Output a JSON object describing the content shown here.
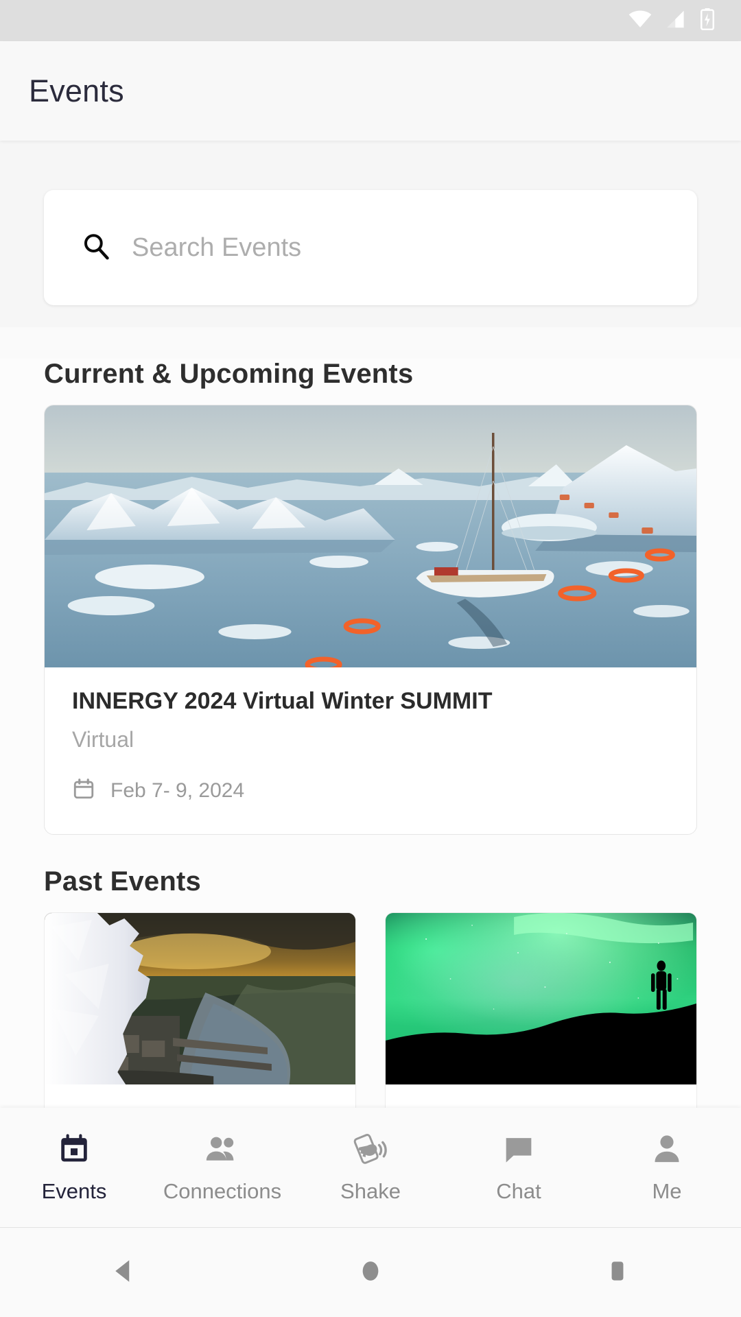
{
  "status_bar": {
    "wifi_icon": "wifi-icon",
    "signal_icon": "cellular-signal-icon",
    "battery_icon": "battery-charging-icon"
  },
  "header": {
    "title": "Events"
  },
  "search": {
    "icon": "search-icon",
    "placeholder": "Search Events",
    "value": ""
  },
  "sections": {
    "current": {
      "title": "Current & Upcoming Events",
      "events": [
        {
          "name": "INNERGY 2024 Virtual Winter SUMMIT",
          "location": "Virtual",
          "date": "Feb  7- 9, 2024",
          "date_icon": "calendar-icon",
          "image_alt": "arctic-icebergs-sailboat"
        }
      ]
    },
    "past": {
      "title": "Past Events",
      "events": [
        {
          "image_alt": "minnesota-river-city-sunset"
        },
        {
          "image_alt": "aurora-borealis-silhouette"
        }
      ]
    }
  },
  "bottom_nav": {
    "active": "Events",
    "items": [
      {
        "label": "Events",
        "icon": "calendar-event-icon"
      },
      {
        "label": "Connections",
        "icon": "people-icon"
      },
      {
        "label": "Shake",
        "icon": "shake-phone-icon"
      },
      {
        "label": "Chat",
        "icon": "chat-bubble-icon"
      },
      {
        "label": "Me",
        "icon": "person-icon"
      }
    ]
  },
  "system_nav": {
    "back": "back-triangle-icon",
    "home": "home-circle-icon",
    "recents": "recents-square-icon"
  },
  "colors": {
    "accent": "#23233a",
    "muted": "#8c8c8c",
    "page_bg": "#fcfcfc",
    "status_bg": "#dedede"
  }
}
